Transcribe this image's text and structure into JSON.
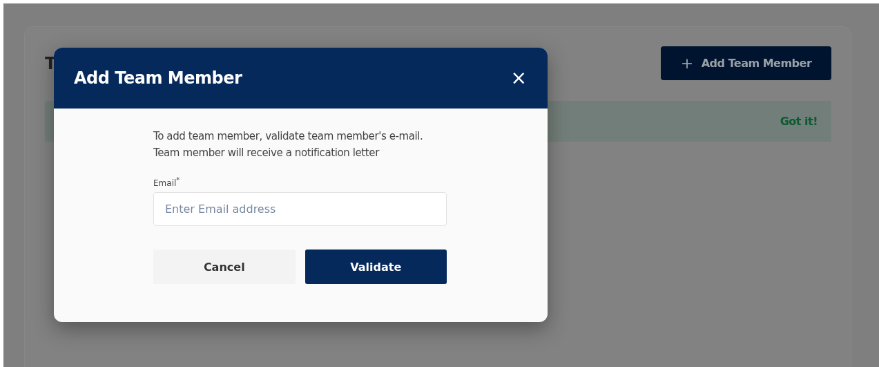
{
  "page": {
    "title_fragment": "T",
    "add_button": {
      "icon": "+",
      "label": "Add Team Member"
    },
    "banner": {
      "action": "Got it!"
    }
  },
  "dialog": {
    "title": "Add Team Member",
    "close": "×",
    "description": "To add team member, validate team member's e-mail. Team member will receive a notification letter",
    "field": {
      "label": "Email",
      "required_mark": "*",
      "placeholder": "Enter Email address"
    },
    "buttons": [
      {
        "label": "Cancel",
        "kind": "secondary"
      },
      {
        "label": "Validate",
        "kind": "primary"
      }
    ]
  }
}
